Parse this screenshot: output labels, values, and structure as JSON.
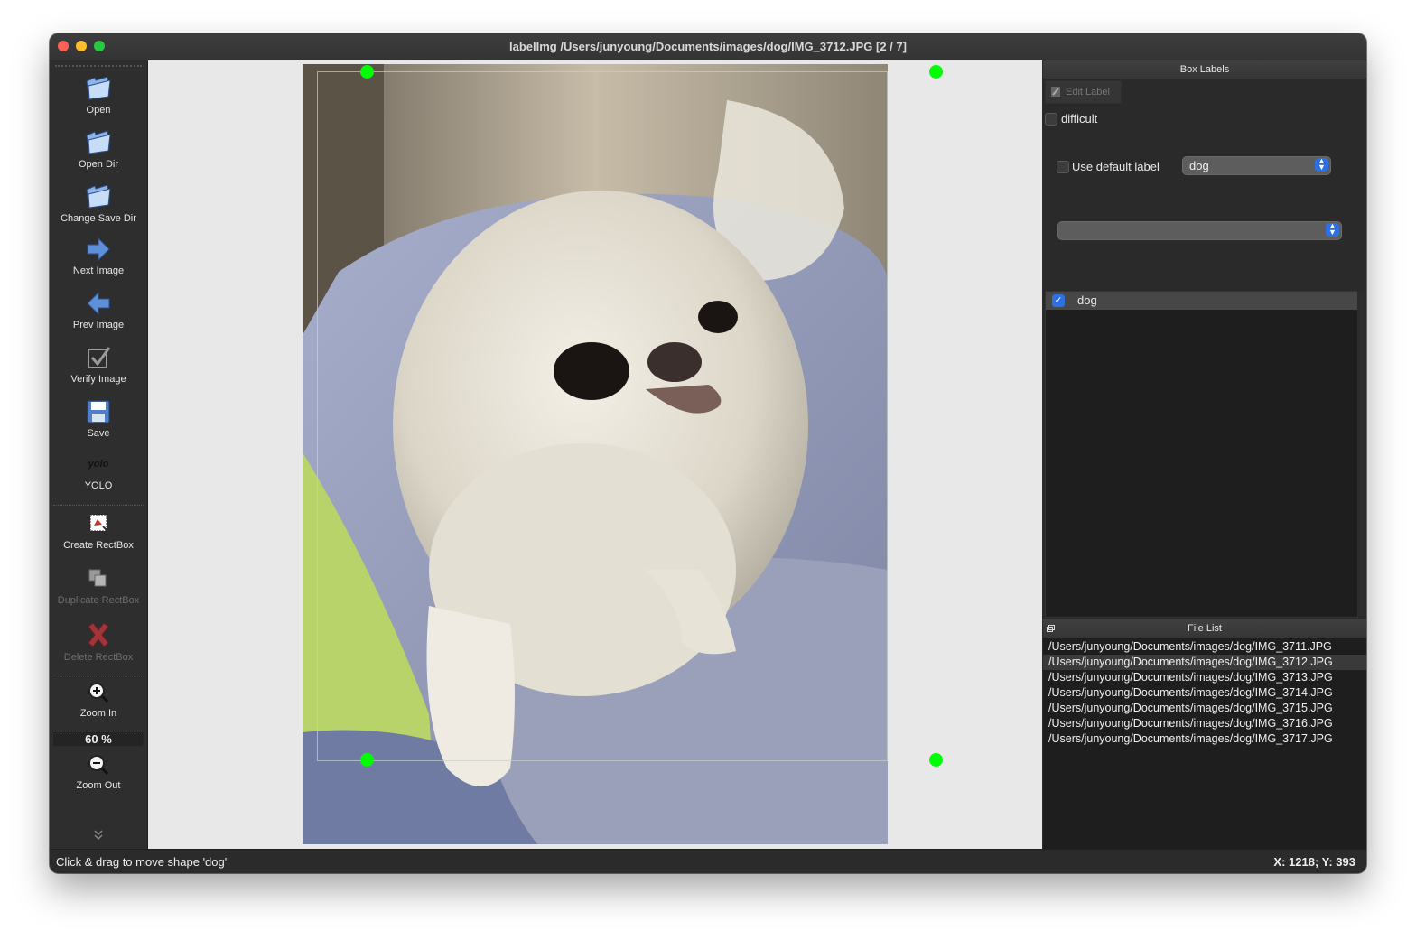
{
  "window": {
    "title": "labelImg /Users/junyoung/Documents/images/dog/IMG_3712.JPG [2 / 7]"
  },
  "toolbar": {
    "open": "Open",
    "open_dir": "Open Dir",
    "change_save_dir": "Change Save Dir",
    "next_image": "Next Image",
    "prev_image": "Prev Image",
    "verify_image": "Verify Image",
    "save": "Save",
    "format_icon_text": "yolo",
    "format": "YOLO",
    "create_rectbox": "Create RectBox",
    "duplicate_rectbox": "Duplicate RectBox",
    "delete_rectbox": "Delete RectBox",
    "zoom_in": "Zoom In",
    "zoom_level": "60 %",
    "zoom_out": "Zoom Out",
    "more_icon": "chevron-double-down-icon"
  },
  "box_labels": {
    "title": "Box Labels",
    "edit_label": "Edit Label",
    "difficult": "difficult",
    "difficult_checked": false,
    "use_default_label": "Use default label",
    "use_default_checked": false,
    "default_label_value": "dog",
    "second_select_value": "",
    "labels": [
      {
        "text": "dog",
        "checked": true
      }
    ]
  },
  "file_list": {
    "title": "File List",
    "selected_index": 1,
    "files": [
      "/Users/junyoung/Documents/images/dog/IMG_3711.JPG",
      "/Users/junyoung/Documents/images/dog/IMG_3712.JPG",
      "/Users/junyoung/Documents/images/dog/IMG_3713.JPG",
      "/Users/junyoung/Documents/images/dog/IMG_3714.JPG",
      "/Users/junyoung/Documents/images/dog/IMG_3715.JPG",
      "/Users/junyoung/Documents/images/dog/IMG_3716.JPG",
      "/Users/junyoung/Documents/images/dog/IMG_3717.JPG"
    ]
  },
  "status": {
    "message": "Click & drag to move shape 'dog'",
    "coords": "X: 1218; Y: 393"
  },
  "colors": {
    "handle": "#00ff00",
    "accent": "#2f6fe4"
  }
}
